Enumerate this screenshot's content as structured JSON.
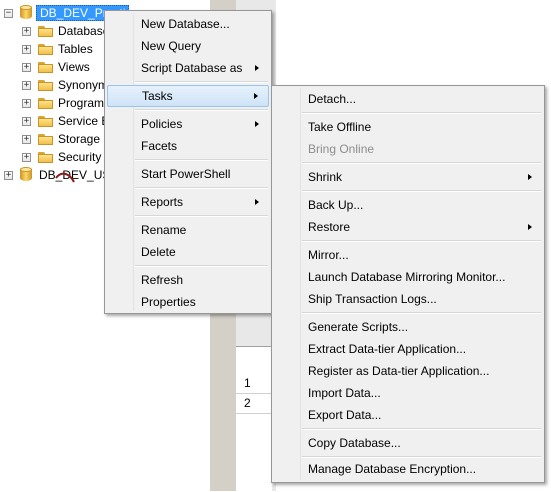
{
  "tree": {
    "root_label": "DB_DEV_Practi",
    "children": [
      {
        "label": "Database"
      },
      {
        "label": "Tables"
      },
      {
        "label": "Views"
      },
      {
        "label": "Synonym"
      },
      {
        "label": "Program"
      },
      {
        "label": "Service B"
      },
      {
        "label": "Storage"
      },
      {
        "label": "Security"
      }
    ],
    "second_db_label": "DB_DEV_USE",
    "expanded_symbol": "−",
    "collapsed_symbol": "+"
  },
  "grid": {
    "rows": [
      "1",
      "2"
    ]
  },
  "context_menu": {
    "items": [
      {
        "label": "New Database..."
      },
      {
        "label": "New Query"
      },
      {
        "label": "Script Database as"
      },
      {
        "label": "Tasks"
      },
      {
        "label": "Policies"
      },
      {
        "label": "Facets"
      },
      {
        "label": "Start PowerShell"
      },
      {
        "label": "Reports"
      },
      {
        "label": "Rename"
      },
      {
        "label": "Delete"
      },
      {
        "label": "Refresh"
      },
      {
        "label": "Properties"
      }
    ]
  },
  "tasks_menu": {
    "items": [
      {
        "label": "Detach..."
      },
      {
        "label": "Take Offline"
      },
      {
        "label": "Bring Online"
      },
      {
        "label": "Shrink"
      },
      {
        "label": "Back Up..."
      },
      {
        "label": "Restore"
      },
      {
        "label": "Mirror..."
      },
      {
        "label": "Launch Database Mirroring Monitor..."
      },
      {
        "label": "Ship Transaction Logs..."
      },
      {
        "label": "Generate Scripts..."
      },
      {
        "label": "Extract Data-tier Application..."
      },
      {
        "label": "Register as Data-tier Application..."
      },
      {
        "label": "Import Data..."
      },
      {
        "label": "Export Data..."
      },
      {
        "label": "Copy Database..."
      },
      {
        "label": "Manage Database Encryption..."
      }
    ]
  },
  "colors": {
    "selection": "#3399ff",
    "menu_bg": "#f0f0f0",
    "highlight_border": "#99c5ec",
    "disabled_text": "#8d8d8d"
  }
}
